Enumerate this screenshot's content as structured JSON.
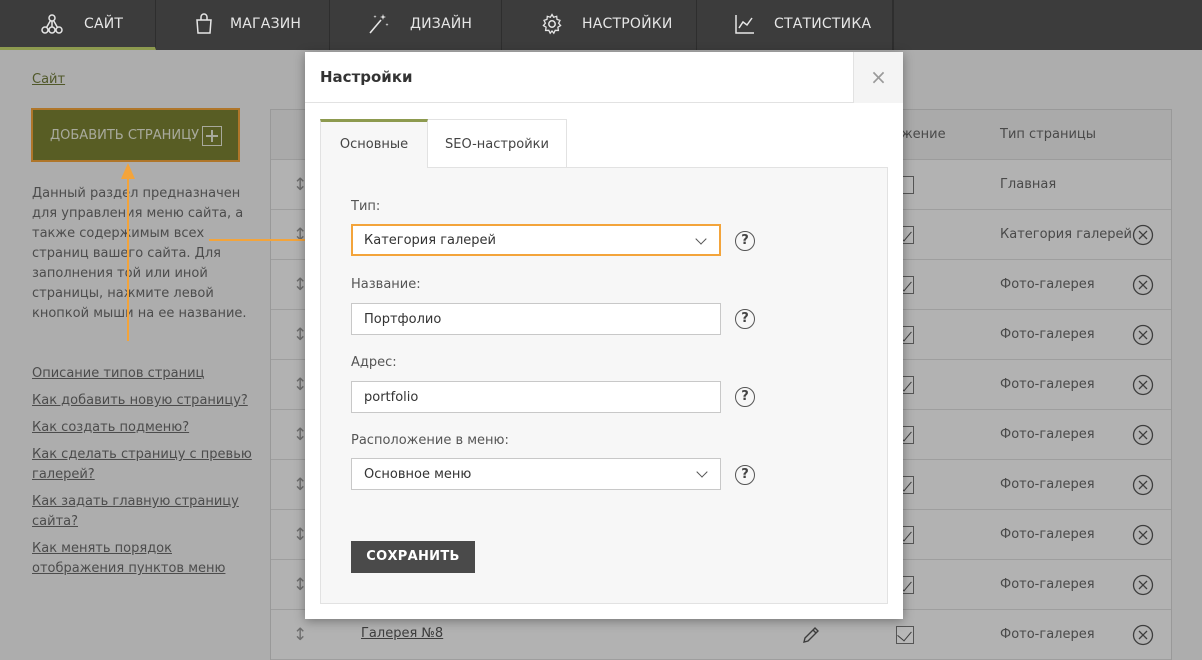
{
  "nav": {
    "items": [
      {
        "label": "САЙТ",
        "icon": "sitemap-icon"
      },
      {
        "label": "МАГАЗИН",
        "icon": "shopping-bag-icon"
      },
      {
        "label": "ДИЗАЙН",
        "icon": "magic-wand-icon"
      },
      {
        "label": "НАСТРОЙКИ",
        "icon": "gear-icon"
      },
      {
        "label": "СТАТИСТИКА",
        "icon": "line-chart-icon"
      }
    ],
    "active_index": 0
  },
  "breadcrumb": "Сайт",
  "sidebar": {
    "add_page_label": "ДОБАВИТЬ СТРАНИЦУ",
    "description": "Данный раздел предназначен для управления меню сайта, а также содержимым всех страниц вашего сайта. Для заполнения той или иной страницы, нажмите левой кнопкой мыши на ее название.",
    "help_links": [
      "Описание типов страниц",
      "Как добавить новую страницу?",
      "Как создать подменю?",
      "Как сделать страницу с превью галерей?",
      "Как задать главную страницу сайта?",
      "Как менять порядок отображения пунктов меню"
    ]
  },
  "table": {
    "headers": {
      "display": "Отображение",
      "display_visible": "ажение",
      "type": "Тип страницы"
    },
    "rows": [
      {
        "title": "",
        "checked": false,
        "type": "Главная",
        "deletable": false
      },
      {
        "title": "",
        "checked": true,
        "type": "Категория галерей",
        "deletable": true
      },
      {
        "title": "",
        "checked": true,
        "type": "Фото-галерея",
        "deletable": true
      },
      {
        "title": "",
        "checked": true,
        "type": "Фото-галерея",
        "deletable": true
      },
      {
        "title": "",
        "checked": true,
        "type": "Фото-галерея",
        "deletable": true
      },
      {
        "title": "",
        "checked": true,
        "type": "Фото-галерея",
        "deletable": true
      },
      {
        "title": "",
        "checked": true,
        "type": "Фото-галерея",
        "deletable": true
      },
      {
        "title": "",
        "checked": true,
        "type": "Фото-галерея",
        "deletable": true
      },
      {
        "title": "",
        "checked": true,
        "type": "Фото-галерея",
        "deletable": true
      },
      {
        "title": "Галерея №8",
        "checked": true,
        "type": "Фото-галерея",
        "deletable": true
      }
    ]
  },
  "modal": {
    "title": "Настройки",
    "close_symbol": "×",
    "tabs": [
      "Основные",
      "SEO-настройки"
    ],
    "active_tab": 0,
    "fields": {
      "type_label": "Тип:",
      "type_value": "Категория галерей",
      "name_label": "Название:",
      "name_value": "Портфолио",
      "address_label": "Адрес:",
      "address_value": "portfolio",
      "menu_label": "Расположение в меню:",
      "menu_value": "Основное меню"
    },
    "help_symbol": "?",
    "save_label": "СОХРАНИТЬ"
  },
  "colors": {
    "nav_bg": "#3c3c3c",
    "accent": "#8d9a4f",
    "add_button": "#7a8233",
    "highlight": "#f3a43b",
    "save_button": "#4a4a4a"
  }
}
